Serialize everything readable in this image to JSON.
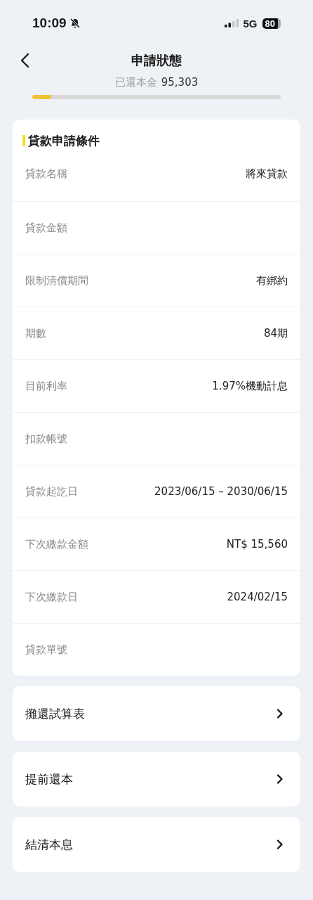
{
  "status_bar": {
    "time": "10:09",
    "network": "5G",
    "battery": "80"
  },
  "nav": {
    "title": "申請狀態"
  },
  "progress": {
    "label": "已還本金",
    "amount": "95,303",
    "level": 0.076
  },
  "section": {
    "title": "貸款申請條件",
    "rows": [
      {
        "label": "貸款名稱",
        "value": "將來貸款"
      },
      {
        "label": "貸款金額"
      },
      {
        "label": "限制清償期間",
        "value": "有綁約"
      },
      {
        "label": "期數",
        "value": "84期"
      },
      {
        "label": "目前利率",
        "value": "1.97%機動計息"
      },
      {
        "label": "扣款帳號"
      },
      {
        "label": "貸款起訖日",
        "value": "2023/06/15 – 2030/06/15"
      },
      {
        "label": "下次繳款金額",
        "value": "NT$ 15,560"
      },
      {
        "label": "下次繳款日",
        "value": "2024/02/15"
      },
      {
        "label": "貸款單號"
      }
    ]
  },
  "actions": [
    {
      "label": "攤還試算表"
    },
    {
      "label": "提前還本"
    },
    {
      "label": "結清本息"
    }
  ]
}
